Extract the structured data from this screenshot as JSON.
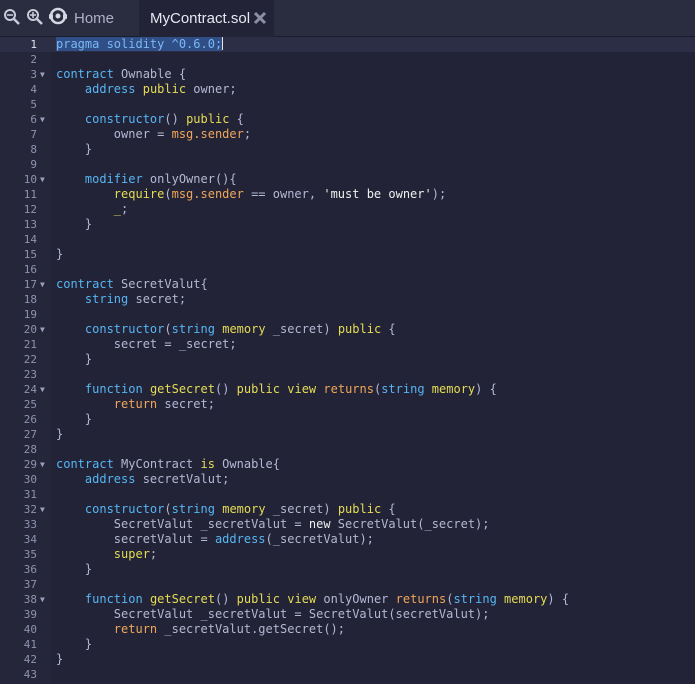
{
  "colors": {
    "keyword": "#56b6f5",
    "ident": "#b4b8d4",
    "yellow": "#e5dc55",
    "orange": "#f0a65a",
    "string": "#f0f0f0",
    "background": "#222336"
  },
  "tabs": [
    {
      "label": "Home",
      "icon": "home-icon"
    },
    {
      "label": "MyContract.sol",
      "icon": "close-icon",
      "active": true
    }
  ],
  "toolbar": {
    "zoom_out_icon": "zoom-out-icon",
    "zoom_in_icon": "zoom-in-icon"
  },
  "editor": {
    "current_line": 1,
    "lines": [
      {
        "n": "1",
        "fold": false,
        "tokens": [
          [
            "pragma solidity ^0.6.0;",
            "sel"
          ]
        ]
      },
      {
        "n": "2",
        "fold": false,
        "tokens": []
      },
      {
        "n": "3",
        "fold": true,
        "tokens": [
          [
            "contract",
            "kw"
          ],
          [
            " Ownable {",
            "id"
          ]
        ]
      },
      {
        "n": "4",
        "fold": false,
        "tokens": [
          [
            "    ",
            "id"
          ],
          [
            "address",
            "kw"
          ],
          [
            " ",
            "id"
          ],
          [
            "public",
            "yl"
          ],
          [
            " owner;",
            "id"
          ]
        ]
      },
      {
        "n": "5",
        "fold": false,
        "tokens": []
      },
      {
        "n": "6",
        "fold": true,
        "tokens": [
          [
            "    ",
            "id"
          ],
          [
            "constructor",
            "kw"
          ],
          [
            "() ",
            "id"
          ],
          [
            "public",
            "yl"
          ],
          [
            " {",
            "id"
          ]
        ]
      },
      {
        "n": "7",
        "fold": false,
        "tokens": [
          [
            "        owner = ",
            "id"
          ],
          [
            "msg.sender",
            "or"
          ],
          [
            ";",
            "id"
          ]
        ]
      },
      {
        "n": "8",
        "fold": false,
        "tokens": [
          [
            "    }",
            "id"
          ]
        ]
      },
      {
        "n": "9",
        "fold": false,
        "tokens": []
      },
      {
        "n": "10",
        "fold": true,
        "tokens": [
          [
            "    ",
            "id"
          ],
          [
            "modifier",
            "kw"
          ],
          [
            " onlyOwner(){",
            "id"
          ]
        ]
      },
      {
        "n": "11",
        "fold": false,
        "tokens": [
          [
            "        ",
            "id"
          ],
          [
            "require",
            "yl"
          ],
          [
            "(",
            "id"
          ],
          [
            "msg.sender",
            "or"
          ],
          [
            " == owner, ",
            "id"
          ],
          [
            "'must be owner'",
            "st"
          ],
          [
            ");",
            "id"
          ]
        ]
      },
      {
        "n": "12",
        "fold": false,
        "tokens": [
          [
            "        ",
            "id"
          ],
          [
            "_",
            "yl"
          ],
          [
            ";",
            "id"
          ]
        ]
      },
      {
        "n": "13",
        "fold": false,
        "tokens": [
          [
            "    }",
            "id"
          ]
        ]
      },
      {
        "n": "14",
        "fold": false,
        "tokens": []
      },
      {
        "n": "15",
        "fold": false,
        "tokens": [
          [
            "}",
            "id"
          ]
        ]
      },
      {
        "n": "16",
        "fold": false,
        "tokens": []
      },
      {
        "n": "17",
        "fold": true,
        "tokens": [
          [
            "contract",
            "kw"
          ],
          [
            " SecretValut{",
            "id"
          ]
        ]
      },
      {
        "n": "18",
        "fold": false,
        "tokens": [
          [
            "    ",
            "id"
          ],
          [
            "string",
            "kw"
          ],
          [
            " secret;",
            "id"
          ]
        ]
      },
      {
        "n": "19",
        "fold": false,
        "tokens": []
      },
      {
        "n": "20",
        "fold": true,
        "tokens": [
          [
            "    ",
            "id"
          ],
          [
            "constructor",
            "kw"
          ],
          [
            "(",
            "id"
          ],
          [
            "string",
            "kw"
          ],
          [
            " ",
            "id"
          ],
          [
            "memory",
            "yl"
          ],
          [
            " _secret) ",
            "id"
          ],
          [
            "public",
            "yl"
          ],
          [
            " {",
            "id"
          ]
        ]
      },
      {
        "n": "21",
        "fold": false,
        "tokens": [
          [
            "        secret = _secret;",
            "id"
          ]
        ]
      },
      {
        "n": "22",
        "fold": false,
        "tokens": [
          [
            "    }",
            "id"
          ]
        ]
      },
      {
        "n": "23",
        "fold": false,
        "tokens": []
      },
      {
        "n": "24",
        "fold": true,
        "tokens": [
          [
            "    ",
            "id"
          ],
          [
            "function",
            "kw"
          ],
          [
            " ",
            "id"
          ],
          [
            "getSecret",
            "yl"
          ],
          [
            "() ",
            "id"
          ],
          [
            "public",
            "yl"
          ],
          [
            " ",
            "id"
          ],
          [
            "view",
            "yl"
          ],
          [
            " ",
            "id"
          ],
          [
            "returns",
            "or"
          ],
          [
            "(",
            "id"
          ],
          [
            "string",
            "kw"
          ],
          [
            " ",
            "id"
          ],
          [
            "memory",
            "yl"
          ],
          [
            ") {",
            "id"
          ]
        ]
      },
      {
        "n": "25",
        "fold": false,
        "tokens": [
          [
            "        ",
            "id"
          ],
          [
            "return",
            "or"
          ],
          [
            " secret;",
            "id"
          ]
        ]
      },
      {
        "n": "26",
        "fold": false,
        "tokens": [
          [
            "    }",
            "id"
          ]
        ]
      },
      {
        "n": "27",
        "fold": false,
        "tokens": [
          [
            "}",
            "id"
          ]
        ]
      },
      {
        "n": "28",
        "fold": false,
        "tokens": []
      },
      {
        "n": "29",
        "fold": true,
        "tokens": [
          [
            "contract",
            "kw"
          ],
          [
            " MyContract ",
            "id"
          ],
          [
            "is",
            "yl"
          ],
          [
            " Ownable{",
            "id"
          ]
        ]
      },
      {
        "n": "30",
        "fold": false,
        "tokens": [
          [
            "    ",
            "id"
          ],
          [
            "address",
            "kw"
          ],
          [
            " secretValut;",
            "id"
          ]
        ]
      },
      {
        "n": "31",
        "fold": false,
        "tokens": []
      },
      {
        "n": "32",
        "fold": true,
        "tokens": [
          [
            "    ",
            "id"
          ],
          [
            "constructor",
            "kw"
          ],
          [
            "(",
            "id"
          ],
          [
            "string",
            "kw"
          ],
          [
            " ",
            "id"
          ],
          [
            "memory",
            "yl"
          ],
          [
            " _secret) ",
            "id"
          ],
          [
            "public",
            "yl"
          ],
          [
            " {",
            "id"
          ]
        ]
      },
      {
        "n": "33",
        "fold": false,
        "tokens": [
          [
            "        SecretValut _secretValut = ",
            "id"
          ],
          [
            "new",
            "st"
          ],
          [
            " SecretValut(_secret);",
            "id"
          ]
        ]
      },
      {
        "n": "34",
        "fold": false,
        "tokens": [
          [
            "        secretValut = ",
            "id"
          ],
          [
            "address",
            "kw"
          ],
          [
            "(_secretValut);",
            "id"
          ]
        ]
      },
      {
        "n": "35",
        "fold": false,
        "tokens": [
          [
            "        ",
            "id"
          ],
          [
            "super",
            "yl"
          ],
          [
            ";",
            "id"
          ]
        ]
      },
      {
        "n": "36",
        "fold": false,
        "tokens": [
          [
            "    }",
            "id"
          ]
        ]
      },
      {
        "n": "37",
        "fold": false,
        "tokens": []
      },
      {
        "n": "38",
        "fold": true,
        "tokens": [
          [
            "    ",
            "id"
          ],
          [
            "function",
            "kw"
          ],
          [
            " ",
            "id"
          ],
          [
            "getSecret",
            "yl"
          ],
          [
            "() ",
            "id"
          ],
          [
            "public",
            "yl"
          ],
          [
            " ",
            "id"
          ],
          [
            "view",
            "yl"
          ],
          [
            " onlyOwner ",
            "id"
          ],
          [
            "returns",
            "or"
          ],
          [
            "(",
            "id"
          ],
          [
            "string",
            "kw"
          ],
          [
            " ",
            "id"
          ],
          [
            "memory",
            "yl"
          ],
          [
            ") {",
            "id"
          ]
        ]
      },
      {
        "n": "39",
        "fold": false,
        "tokens": [
          [
            "        SecretValut _secretValut = SecretValut(secretValut);",
            "id"
          ]
        ]
      },
      {
        "n": "40",
        "fold": false,
        "tokens": [
          [
            "        ",
            "id"
          ],
          [
            "return",
            "or"
          ],
          [
            " _secretValut.getSecret();",
            "id"
          ]
        ]
      },
      {
        "n": "41",
        "fold": false,
        "tokens": [
          [
            "    }",
            "id"
          ]
        ]
      },
      {
        "n": "42",
        "fold": false,
        "tokens": [
          [
            "}",
            "id"
          ]
        ]
      },
      {
        "n": "43",
        "fold": false,
        "tokens": []
      }
    ]
  }
}
